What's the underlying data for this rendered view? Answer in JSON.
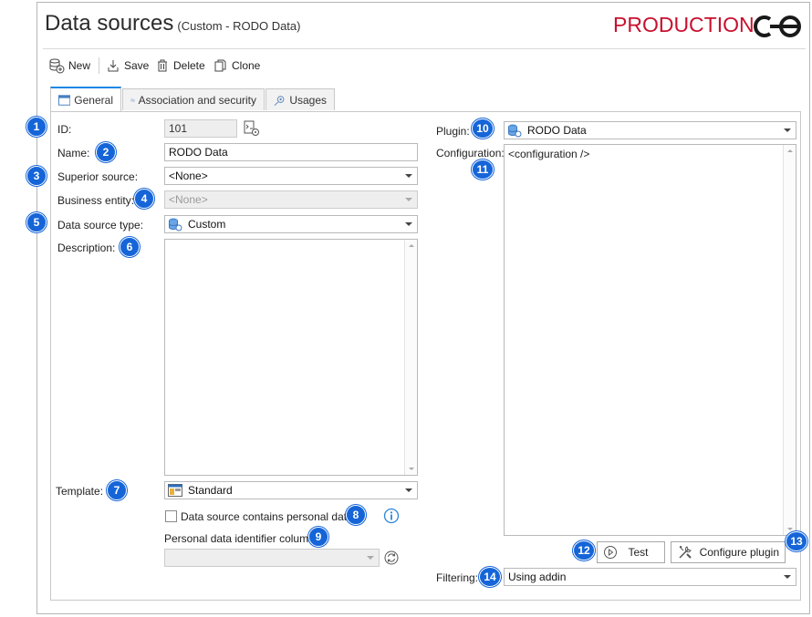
{
  "header": {
    "title": "Data sources",
    "subtitle": "(Custom - RODO Data)",
    "environment": "PRODUCTION",
    "accent_color": "#c8102e"
  },
  "toolbar": {
    "new_label": "New",
    "save_label": "Save",
    "delete_label": "Delete",
    "clone_label": "Clone"
  },
  "tabs": [
    {
      "label": "General",
      "active": true
    },
    {
      "label": "Association and security",
      "active": false
    },
    {
      "label": "Usages",
      "active": false
    }
  ],
  "form": {
    "id_label": "ID:",
    "id_value": "101",
    "name_label": "Name:",
    "name_value": "RODO Data",
    "superior_label": "Superior source:",
    "superior_value": "<None>",
    "business_label": "Business entity:",
    "business_value": "<None>",
    "type_label": "Data source type:",
    "type_value": "Custom",
    "description_label": "Description:",
    "description_value": "",
    "template_label": "Template:",
    "template_value": "Standard",
    "personal_checkbox_label": "Data source contains personal data",
    "personal_checked": false,
    "personal_column_label": "Personal data identifier column:",
    "personal_column_value": ""
  },
  "right": {
    "plugin_label": "Plugin:",
    "plugin_value": "RODO Data",
    "configuration_label": "Configuration:",
    "configuration_value": "<configuration />",
    "test_label": "Test",
    "configure_label": "Configure plugin",
    "filtering_label": "Filtering:",
    "filtering_value": "Using addin"
  },
  "badges": [
    "1",
    "2",
    "3",
    "4",
    "5",
    "6",
    "7",
    "8",
    "9",
    "10",
    "11",
    "12",
    "13",
    "14"
  ]
}
